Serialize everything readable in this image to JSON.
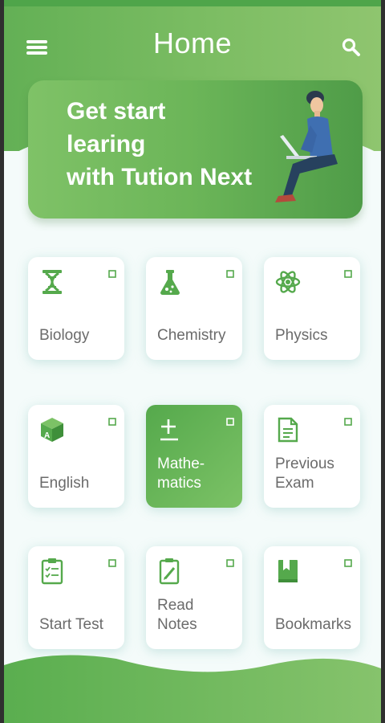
{
  "header": {
    "title": "Home",
    "menu_icon": "hamburger-menu-icon",
    "search_icon": "search-icon"
  },
  "banner": {
    "line1": "Get start",
    "line2": "learing",
    "line3": "with Tution Next",
    "illustration": "person-with-laptop"
  },
  "colors": {
    "accent": "#5aae4f",
    "label": "#6b6b6b",
    "background": "#f4fbfa"
  },
  "tiles": [
    {
      "label": "Biology",
      "icon": "dna-icon",
      "active": false
    },
    {
      "label": "Chemistry",
      "icon": "flask-icon",
      "active": false
    },
    {
      "label": "Physics",
      "icon": "atom-icon",
      "active": false
    },
    {
      "label": "English",
      "icon": "alphabet-cube-icon",
      "active": false
    },
    {
      "label": "Mathe-\nmatics",
      "icon": "plus-minus-icon",
      "active": true
    },
    {
      "label": "Previous\nExam",
      "icon": "document-icon",
      "active": false
    },
    {
      "label": "Start Test",
      "icon": "clipboard-checklist-icon",
      "active": false
    },
    {
      "label": "Read\nNotes",
      "icon": "notepad-pencil-icon",
      "active": false
    },
    {
      "label": "Bookmarks",
      "icon": "bookmark-book-icon",
      "active": false
    }
  ]
}
